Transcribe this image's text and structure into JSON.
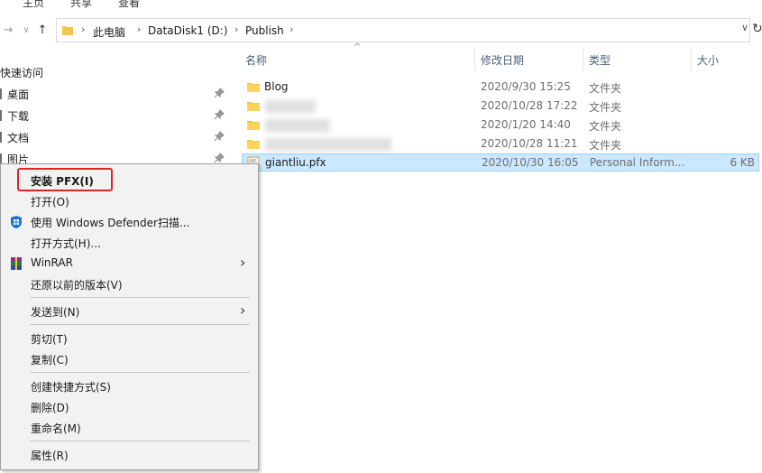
{
  "ribbon": {
    "tabs": [
      "主页",
      "共享",
      "查看"
    ]
  },
  "address": {
    "segments": [
      "此电脑",
      "DataDisk1 (D:)",
      "Publish"
    ]
  },
  "nav_pane": {
    "header": "快速访问",
    "items": [
      {
        "label": "桌面"
      },
      {
        "label": "下载"
      },
      {
        "label": "文档"
      },
      {
        "label": "图片"
      }
    ]
  },
  "columns": {
    "name": "名称",
    "date": "修改日期",
    "type": "类型",
    "size": "大小"
  },
  "files": [
    {
      "name": "Blog",
      "date": "2020/9/30 15:25",
      "type": "文件夹",
      "size": ""
    },
    {
      "name": "",
      "date": "2020/10/28 17:22",
      "type": "文件夹",
      "size": ""
    },
    {
      "name": "",
      "date": "2020/1/20 14:40",
      "type": "文件夹",
      "size": ""
    },
    {
      "name": "",
      "date": "2020/10/28 11:21",
      "type": "文件夹",
      "size": ""
    },
    {
      "name": "giantliu.pfx",
      "date": "2020/10/30 16:05",
      "type": "Personal Inform...",
      "size": "6 KB"
    }
  ],
  "context_menu": {
    "items": [
      {
        "label": "安装 PFX(I)",
        "icon": "",
        "submenu": false
      },
      {
        "label": "打开(O)",
        "icon": "",
        "submenu": false
      },
      {
        "label": "使用 Windows Defender扫描...",
        "icon": "windows-defender-icon",
        "submenu": false
      },
      {
        "label": "打开方式(H)...",
        "icon": "",
        "submenu": false
      },
      {
        "label": "WinRAR",
        "icon": "winrar-icon",
        "submenu": true
      },
      {
        "label": "还原以前的版本(V)",
        "icon": "",
        "submenu": false
      },
      {
        "label": "发送到(N)",
        "icon": "",
        "submenu": true
      },
      {
        "label": "剪切(T)",
        "icon": "",
        "submenu": false
      },
      {
        "label": "复制(C)",
        "icon": "",
        "submenu": false
      },
      {
        "label": "创建快捷方式(S)",
        "icon": "",
        "submenu": false
      },
      {
        "label": "删除(D)",
        "icon": "",
        "submenu": false
      },
      {
        "label": "重命名(M)",
        "icon": "",
        "submenu": false
      },
      {
        "label": "属性(R)",
        "icon": "",
        "submenu": false
      }
    ]
  },
  "colors": {
    "selection": "#cce8ff",
    "highlight_box": "#e02424",
    "folder": "#f4c54d"
  }
}
